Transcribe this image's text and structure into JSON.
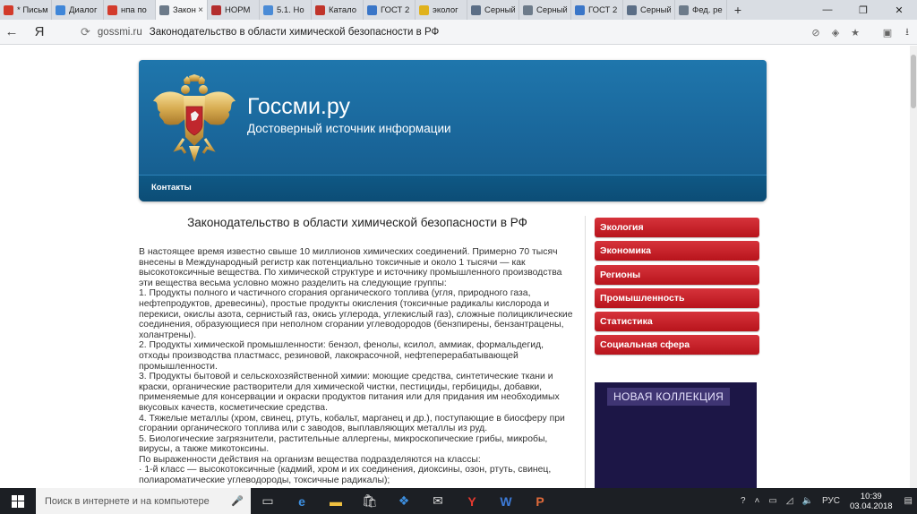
{
  "browser": {
    "tabs": [
      {
        "label": "* Письм",
        "color": "#d23a2a",
        "active": false
      },
      {
        "label": "Диалог",
        "color": "#3f86d8",
        "active": false
      },
      {
        "label": "нпа по",
        "color": "#d33b2c",
        "active": false
      },
      {
        "label": "Закон",
        "color": "#6d7b8a",
        "active": true
      },
      {
        "label": "НОРМ",
        "color": "#b32d2d",
        "active": false
      },
      {
        "label": "5.1. Но",
        "color": "#4a8bd6",
        "active": false
      },
      {
        "label": "Катало",
        "color": "#c0342a",
        "active": false
      },
      {
        "label": "ГОСТ 2",
        "color": "#3a76c8",
        "active": false
      },
      {
        "label": "эколог",
        "color": "#e0b21d",
        "active": false
      },
      {
        "label": "Серный",
        "color": "#5b6e86",
        "active": false
      },
      {
        "label": "Серный",
        "color": "#6d7b8a",
        "active": false
      },
      {
        "label": "ГОСТ 2",
        "color": "#3a76c8",
        "active": false
      },
      {
        "label": "Серный",
        "color": "#5b6e86",
        "active": false
      },
      {
        "label": "Фед. ре",
        "color": "#6d7b8a",
        "active": false
      }
    ],
    "new_tab": "+",
    "window_controls": {
      "minimize": "—",
      "restore": "❐",
      "close": "✕"
    },
    "back_icon": "←",
    "yandex_button": "Я",
    "url_domain": "gossmi.ru",
    "page_title": "Законодательство в области химической безопасности в РФ"
  },
  "site": {
    "title": "Госсми.ру",
    "slogan": "Достоверный источник информации",
    "nav": [
      "Контакты"
    ]
  },
  "article": {
    "heading": "Законодательство в области химической безопасности в РФ",
    "paragraphs": [
      "В настоящее время известно свыше 10 миллионов химических соединений. Примерно 70 тысяч внесены в Международный регистр как потенциально токсичные и около 1 тысячи — как высокотоксичные вещества. По химической структуре и источнику промышленного производства эти вещества весьма условно можно разделить на следующие группы:",
      "1. Продукты полного и частичного сгорания органического топлива (угля, природного газа, нефтепродуктов, древесины), простые продукты окисления (токсичные радикалы кислорода и перекиси, окислы азота, сернистый газ, окись углерода, углекислый газ), сложные полициклические соединения, образующиеся при неполном сгорании углеводородов (бензпирены, бензантрацены, холантрены).",
      "2. Продукты химической промышленности: бензол, фенолы, ксилол, аммиак, формальдегид, отходы производства пластмасс, резиновой, лакокрасочной, нефтеперерабатывающей промышленности.",
      "3. Продукты бытовой и сельскохозяйственной химии: моющие средства, синтетические ткани и краски, органические растворители для химической чистки, пестициды, гербициды, добавки, применяемые для консервации и окраски продуктов питания или для придания им необходимых вкусовых качеств, косметические средства.",
      "4. Тяжелые металлы (хром, свинец, ртуть, кобальт, марганец и др.), поступающие в биосферу при сгорании органического топлива или с заводов, выплавляющих металлы из руд.",
      "5. Биологические загрязнители, растительные аллергены, микроскопические грибы, микробы, вирусы, а также микотоксины.",
      "По выраженности действия на организм вещества подразделяются на классы:",
      "·       1-й класс — высокотоксичные (кадмий, хром и их соединения, диоксины, озон, ртуть, свинец, полиароматические углеводороды, токсичные радикалы);"
    ]
  },
  "sidebar": {
    "items": [
      "Экология",
      "Экономика",
      "Регионы",
      "Промышленность",
      "Статистика",
      "Социальная сфера"
    ]
  },
  "ad": {
    "label": "НОВАЯ КОЛЛЕКЦИЯ"
  },
  "taskbar": {
    "search_placeholder": "Поиск в интернете и на компьютере",
    "language": "РУС",
    "time": "10:39",
    "date": "03.04.2018"
  }
}
